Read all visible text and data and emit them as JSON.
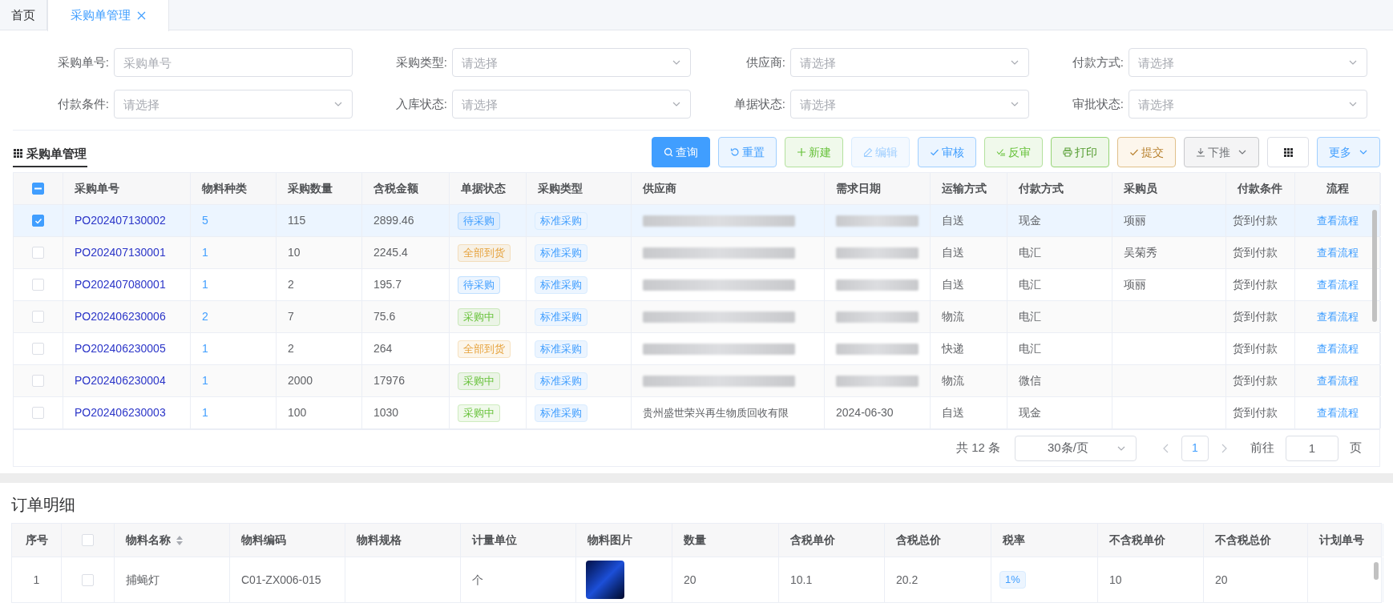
{
  "tabs": [
    {
      "label": "首页",
      "selected": false,
      "closable": false
    },
    {
      "label": "采购单管理",
      "selected": true,
      "closable": true
    }
  ],
  "filters": [
    {
      "label": "采购单号:",
      "placeholder": "采购单号",
      "kind": "input"
    },
    {
      "label": "采购类型:",
      "placeholder": "请选择",
      "kind": "select"
    },
    {
      "label": "供应商:",
      "placeholder": "请选择",
      "kind": "select"
    },
    {
      "label": "付款方式:",
      "placeholder": "请选择",
      "kind": "select"
    },
    {
      "label": "付款条件:",
      "placeholder": "请选择",
      "kind": "select"
    },
    {
      "label": "入库状态:",
      "placeholder": "请选择",
      "kind": "select"
    },
    {
      "label": "单据状态:",
      "placeholder": "请选择",
      "kind": "select"
    },
    {
      "label": "审批状态:",
      "placeholder": "请选择",
      "kind": "select"
    }
  ],
  "section_title": "采购单管理",
  "toolbar": [
    {
      "label": "查询",
      "kind": "primary"
    },
    {
      "label": "重置",
      "kind": "info"
    },
    {
      "label": "新建",
      "kind": "success"
    },
    {
      "label": "编辑",
      "kind": "info-disabled"
    },
    {
      "label": "审核",
      "kind": "info"
    },
    {
      "label": "反审",
      "kind": "success"
    },
    {
      "label": "打印",
      "kind": "success-dark"
    },
    {
      "label": "提交",
      "kind": "warning"
    },
    {
      "label": "下推",
      "kind": "gray",
      "dropdown": true
    },
    {
      "kind": "plain"
    },
    {
      "label": "更多",
      "kind": "info",
      "dropdown": true
    }
  ],
  "table": {
    "header_indeterminate": true,
    "columns": [
      "采购单号",
      "物料种类",
      "采购数量",
      "含税金额",
      "单据状态",
      "采购类型",
      "供应商",
      "需求日期",
      "运输方式",
      "付款方式",
      "采购员",
      "付款条件",
      "流程"
    ],
    "rows": [
      {
        "selected": true,
        "checked": true,
        "order_no": "PO202407130002",
        "material_types": "5",
        "quantity": "115",
        "amount": "2899.46",
        "status": {
          "text": "待采购",
          "color": "#409eff"
        },
        "purchase_type": "标准采购",
        "supplier_blurred": true,
        "date_blurred": true,
        "shipping": "自送",
        "payment": "现金",
        "buyer": "项丽",
        "terms": "货到付款",
        "flow": "查看流程"
      },
      {
        "selected": false,
        "checked": false,
        "order_no": "PO202407130001",
        "material_types": "1",
        "quantity": "10",
        "amount": "2245.4",
        "status": {
          "text": "全部到货",
          "color": "#e6a23c"
        },
        "purchase_type": "标准采购",
        "supplier_blurred": true,
        "date_blurred": true,
        "shipping": "自送",
        "payment": "电汇",
        "buyer": "吴菊秀",
        "terms": "货到付款",
        "flow": "查看流程"
      },
      {
        "selected": false,
        "checked": false,
        "order_no": "PO202407080001",
        "material_types": "1",
        "quantity": "2",
        "amount": "195.7",
        "status": {
          "text": "待采购",
          "color": "#409eff"
        },
        "purchase_type": "标准采购",
        "supplier_blurred": true,
        "date_blurred": true,
        "shipping": "自送",
        "payment": "电汇",
        "buyer": "项丽",
        "terms": "货到付款",
        "flow": "查看流程"
      },
      {
        "selected": false,
        "checked": false,
        "order_no": "PO202406230006",
        "material_types": "2",
        "quantity": "7",
        "amount": "75.6",
        "status": {
          "text": "采购中",
          "color": "#67c23a"
        },
        "purchase_type": "标准采购",
        "supplier_blurred": true,
        "date_blurred": true,
        "shipping": "物流",
        "payment": "电汇",
        "terms": "货到付款",
        "flow": "查看流程"
      },
      {
        "selected": false,
        "checked": false,
        "order_no": "PO202406230005",
        "material_types": "1",
        "quantity": "2",
        "amount": "264",
        "status": {
          "text": "全部到货",
          "color": "#e6a23c"
        },
        "purchase_type": "标准采购",
        "supplier_blurred": true,
        "date_blurred": true,
        "shipping": "快递",
        "payment": "电汇",
        "terms": "货到付款",
        "flow": "查看流程"
      },
      {
        "selected": false,
        "checked": false,
        "order_no": "PO202406230004",
        "material_types": "1",
        "quantity": "2000",
        "amount": "17976",
        "status": {
          "text": "采购中",
          "color": "#67c23a"
        },
        "purchase_type": "标准采购",
        "supplier_blurred": true,
        "date_blurred": true,
        "shipping": "物流",
        "payment": "微信",
        "terms": "货到付款",
        "flow": "查看流程"
      },
      {
        "selected": false,
        "checked": false,
        "order_no": "PO202406230003",
        "material_types": "1",
        "quantity": "100",
        "amount": "1030",
        "status": {
          "text": "采购中",
          "color": "#67c23a"
        },
        "purchase_type": "标准采购",
        "supplier": "贵州盛世荣兴再生物质回收有限",
        "date": "2024-06-30",
        "shipping": "自送",
        "payment": "现金",
        "terms": "货到付款",
        "flow": "查看流程"
      }
    ]
  },
  "pagination": {
    "total": "共 12 条",
    "page_size": "30条/页",
    "pages": [
      {
        "label": "1",
        "selected": true
      }
    ],
    "goto_label": "前往",
    "goto_value": "1",
    "goto_suffix": "页"
  },
  "detail": {
    "title": "订单明细",
    "header_checked": false,
    "columns": [
      {
        "label": "序号"
      },
      {
        "kind": "checkbox"
      },
      {
        "label": "物料名称",
        "sortable": true
      },
      {
        "label": "物料编码"
      },
      {
        "label": "物料规格"
      },
      {
        "label": "计量单位"
      },
      {
        "label": "物料图片"
      },
      {
        "label": "数量"
      },
      {
        "label": "含税单价"
      },
      {
        "label": "含税总价"
      },
      {
        "label": "税率"
      },
      {
        "label": "不含税单价"
      },
      {
        "label": "不含税总价"
      },
      {
        "label": "计划单号"
      }
    ],
    "rows": [
      {
        "checked": false,
        "index": "1",
        "name": "捕蝇灯",
        "code": "C01-ZX006-015",
        "unit": "个",
        "has_image": true,
        "quantity": "20",
        "unit_price": "10.1",
        "total": "20.2",
        "tax_rate": "1%",
        "net_unit_price": "10",
        "net_total": "20"
      }
    ]
  }
}
